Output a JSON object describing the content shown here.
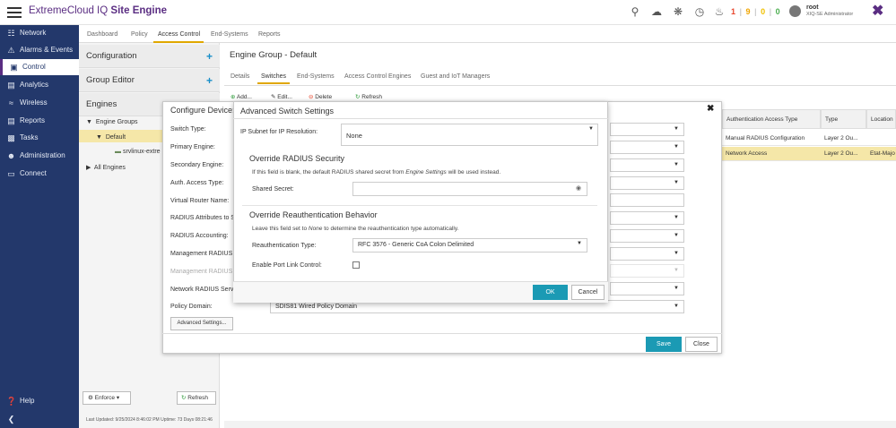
{
  "app": {
    "brand": "ExtremeCloud IQ",
    "product": "Site Engine"
  },
  "header": {
    "counts": [
      "1",
      "9",
      "0",
      "0"
    ],
    "count_colors": [
      "#e8462d",
      "#f0a500",
      "#f0c000",
      "#4caf50"
    ],
    "user_name": "root",
    "user_role": "XIQ-SE Administrator"
  },
  "leftnav": {
    "items": [
      {
        "label": "Network",
        "icon": "network-icon"
      },
      {
        "label": "Alarms & Events",
        "icon": "alarm-icon"
      },
      {
        "label": "Control",
        "icon": "lock-icon"
      },
      {
        "label": "Analytics",
        "icon": "chart-icon"
      },
      {
        "label": "Wireless",
        "icon": "wifi-icon"
      },
      {
        "label": "Reports",
        "icon": "report-icon"
      },
      {
        "label": "Tasks",
        "icon": "tasks-icon"
      },
      {
        "label": "Administration",
        "icon": "users-icon"
      },
      {
        "label": "Connect",
        "icon": "connect-icon"
      }
    ],
    "help": "Help"
  },
  "subtabs": [
    "Dashboard",
    "Policy",
    "Access Control",
    "End-Systems",
    "Reports"
  ],
  "leftpanel": {
    "configuration": "Configuration",
    "group_editor": "Group Editor",
    "engines": "Engines",
    "tree": {
      "engine_groups": "Engine Groups",
      "default": "Default",
      "srv": "srvlinux-extre",
      "all_engines": "All Engines"
    },
    "enforce": "Enforce",
    "refresh": "Refresh",
    "last_updated": "Last Updated: 9/25/2024 8:46:02 PM   Uptime: 73 Days 08:21:46"
  },
  "main": {
    "title": "Engine Group - Default",
    "tabs": [
      "Details",
      "Switches",
      "End-Systems",
      "Access Control Engines",
      "Guest and IoT Managers"
    ],
    "toolbar": {
      "add": "Add...",
      "edit": "Edit...",
      "delete": "Delete",
      "refresh": "Refresh"
    }
  },
  "right_table": {
    "headers": [
      "Authentication Access Type",
      "Type",
      "Location"
    ],
    "rows": [
      [
        "Manual RADIUS Configuration",
        "Layer 2 Ou...",
        ""
      ],
      [
        "Network Access",
        "Layer 2 Ou...",
        "Etat-Majo"
      ]
    ]
  },
  "configure_device": {
    "title": "Configure Device:",
    "labels": [
      "Switch Type:",
      "Primary Engine:",
      "Secondary Engine:",
      "Auth. Access Type:",
      "Virtual Router Name:",
      "RADIUS Attributes to S",
      "RADIUS Accounting:",
      "Management RADIUS S",
      "Management RADIUS",
      "Network RADIUS Serve",
      "Policy Domain:"
    ],
    "policy_domain_value": "SDIS81 Wired Policy Domain",
    "advanced_settings": "Advanced Settings...",
    "save": "Save",
    "close": "Close"
  },
  "advanced": {
    "title": "Advanced Switch Settings",
    "ip_subnet_label": "IP Subnet for IP Resolution:",
    "ip_subnet_value": "None",
    "radius_section": "Override RADIUS Security",
    "radius_note_pre": "If this field is blank, the default RADIUS shared secret from ",
    "radius_note_em": "Engine Settings",
    "radius_note_post": " will be used instead.",
    "shared_secret_label": "Shared Secret:",
    "reauth_section": "Override Reauthentication Behavior",
    "reauth_note_pre": "Leave this field set to ",
    "reauth_note_em": "None",
    "reauth_note_post": " to determine the reauthentication type automatically.",
    "reauth_type_label": "Reauthentication Type:",
    "reauth_type_value": "RFC 3576 - Generic CoA Colon Delimited",
    "port_link_label": "Enable Port Link Control:",
    "ok": "OK",
    "cancel": "Cancel"
  }
}
